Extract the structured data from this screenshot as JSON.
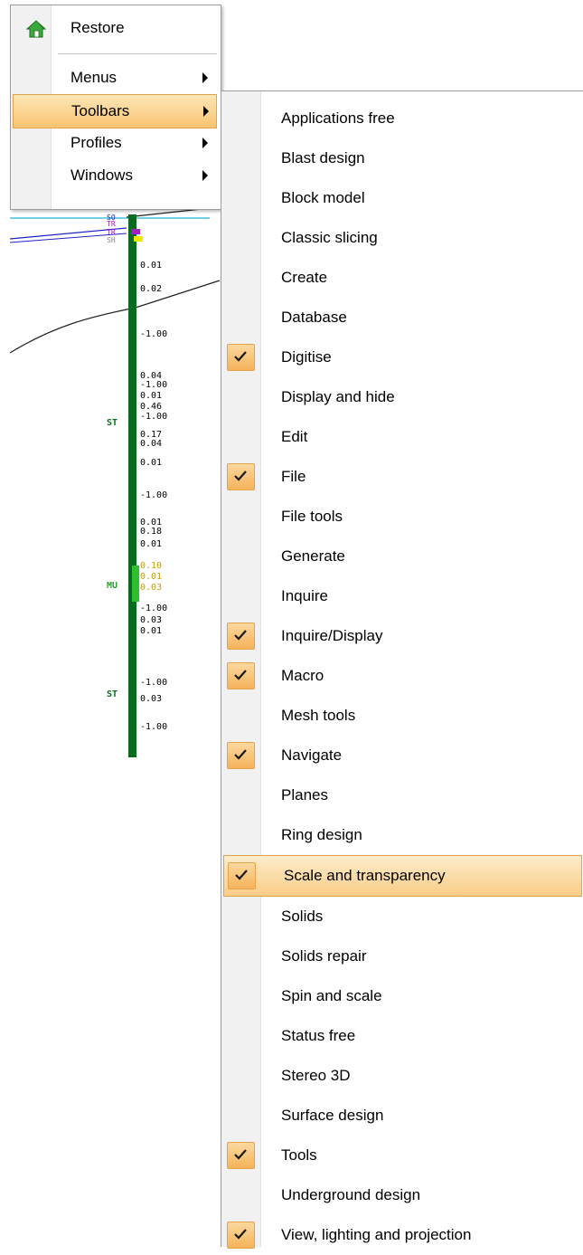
{
  "main_menu": {
    "items": [
      {
        "label": "Restore",
        "icon": "home-icon",
        "submenu": false
      },
      {
        "label": "Menus",
        "submenu": true
      },
      {
        "label": "Toolbars",
        "submenu": true,
        "highlighted": true
      },
      {
        "label": "Profiles",
        "submenu": true
      },
      {
        "label": "Windows",
        "submenu": true
      }
    ]
  },
  "toolbars_submenu": {
    "items": [
      {
        "label": "Applications free",
        "checked": false
      },
      {
        "label": "Blast design",
        "checked": false
      },
      {
        "label": "Block model",
        "checked": false
      },
      {
        "label": "Classic slicing",
        "checked": false
      },
      {
        "label": "Create",
        "checked": false
      },
      {
        "label": "Database",
        "checked": false
      },
      {
        "label": "Digitise",
        "checked": true
      },
      {
        "label": "Display and hide",
        "checked": false
      },
      {
        "label": "Edit",
        "checked": false
      },
      {
        "label": "File",
        "checked": true
      },
      {
        "label": "File tools",
        "checked": false
      },
      {
        "label": "Generate",
        "checked": false
      },
      {
        "label": "Inquire",
        "checked": false
      },
      {
        "label": "Inquire/Display",
        "checked": true
      },
      {
        "label": "Macro",
        "checked": true
      },
      {
        "label": "Mesh tools",
        "checked": false
      },
      {
        "label": "Navigate",
        "checked": true
      },
      {
        "label": "Planes",
        "checked": false
      },
      {
        "label": "Ring design",
        "checked": false
      },
      {
        "label": "Scale and transparency",
        "checked": true,
        "highlighted": true
      },
      {
        "label": "Solids",
        "checked": false
      },
      {
        "label": "Solids repair",
        "checked": false
      },
      {
        "label": "Spin and scale",
        "checked": false
      },
      {
        "label": "Status free",
        "checked": false
      },
      {
        "label": "Stereo 3D",
        "checked": false
      },
      {
        "label": "Surface design",
        "checked": false
      },
      {
        "label": "Tools",
        "checked": true
      },
      {
        "label": "Underground design",
        "checked": false
      },
      {
        "label": "View, lighting and projection",
        "checked": true
      }
    ]
  },
  "drillhole": {
    "values": [
      "0.01",
      "0.02",
      "-1.00",
      "0.04",
      "-1.00",
      "0.01",
      "0.46",
      "-1.00",
      "0.17",
      "0.04",
      "0.01",
      "-1.00",
      "0.01",
      "0.18",
      "0.01",
      "0.10",
      "0.01",
      "0.03",
      "-1.00",
      "0.03",
      "0.01",
      "-1.00",
      "0.03",
      "-1.00"
    ],
    "codes": [
      "ST",
      "MU",
      "ST"
    ],
    "top_codes": [
      "SO",
      "TR",
      "TR",
      "SH"
    ],
    "colors": {
      "hole": "#0a6a1f",
      "section_line": "#2a2a2a",
      "cyan_line": "#1fb8d8",
      "blue_line": "#2020c8"
    }
  },
  "colors": {
    "accent": "#f8c372",
    "check_accent": "#f5b35b"
  }
}
